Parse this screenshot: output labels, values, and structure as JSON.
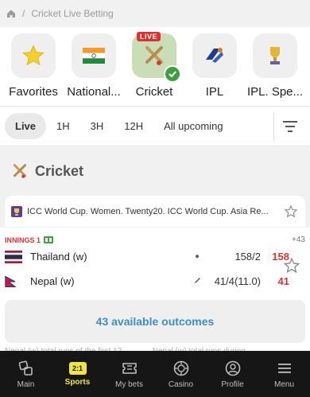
{
  "breadcrumb": {
    "current": "Cricket Live Betting"
  },
  "categories": [
    {
      "label": "Favorites",
      "icon": "star-icon"
    },
    {
      "label": "National...",
      "icon": "india-flag-icon"
    },
    {
      "label": "Cricket",
      "icon": "cricket-icon",
      "badge": "LIVE",
      "selected": true
    },
    {
      "label": "IPL",
      "icon": "ipl-logo-icon"
    },
    {
      "label": "IPL. Spe...",
      "icon": "trophy-icon"
    }
  ],
  "filters": {
    "items": [
      "Live",
      "1H",
      "3H",
      "12H",
      "All upcoming"
    ],
    "active": "Live"
  },
  "section": {
    "title": "Cricket"
  },
  "league": {
    "name": "ICC World Cup. Women. Twenty20. ICC World Cup. Asia Re..."
  },
  "match": {
    "innings": "INNINGS 1",
    "more": "+43",
    "teams": [
      {
        "name": "Thailand (w)",
        "score": "158/2",
        "total": "158"
      },
      {
        "name": "Nepal (w)",
        "score": "41/4(11.0)",
        "total": "41"
      }
    ],
    "outcomes": "43 available outcomes"
  },
  "peek": [
    "Nepal (w) total runs of the first 12...",
    "Nepal (w) total runs during..."
  ],
  "tabbar": [
    {
      "label": "Main",
      "icon": "main-icon"
    },
    {
      "label": "Sports",
      "icon": "sports-icon",
      "badge": "2:1",
      "active": true
    },
    {
      "label": "My bets",
      "icon": "ticket-icon"
    },
    {
      "label": "Casino",
      "icon": "casino-chip-icon"
    },
    {
      "label": "Profile",
      "icon": "profile-icon"
    },
    {
      "label": "Menu",
      "icon": "menu-icon"
    }
  ],
  "colors": {
    "accent_yellow": "#f1e63c",
    "live_red": "#e02f2f",
    "score_red": "#d33333",
    "link_blue": "#3b8ec9",
    "selected_tile": "#c9ddb7"
  }
}
